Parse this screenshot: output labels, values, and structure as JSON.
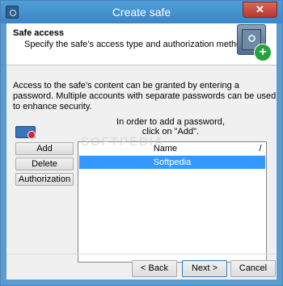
{
  "window": {
    "title": "Create safe",
    "close": "✕"
  },
  "header": {
    "title": "Safe access",
    "subtitle": "Specify the safe’s access type and authorization method."
  },
  "info": "Access to the safe’s content can be granted by entering a password. Multiple accounts with separate passwords can be used to enhance security.",
  "hint": {
    "line1": "In order to add a password,",
    "line2": "click on \"Add\"."
  },
  "buttons": {
    "add": "Add",
    "delete": "Delete",
    "authorization": "Authorization"
  },
  "list": {
    "columns": {
      "name": "Name",
      "sort": "/"
    },
    "rows": [
      {
        "name": "Softpedia",
        "selected": true
      }
    ]
  },
  "watermark": "SOFTPEDIA",
  "footer": {
    "back": "< Back",
    "next": "Next >",
    "cancel": "Cancel"
  },
  "colors": {
    "selection": "#3399ff",
    "titlebar": "#3b86c6",
    "close": "#c24a3f",
    "badge": "#27a33b"
  },
  "icons": {
    "app": "safe-icon",
    "header": "safe-icon",
    "badge": "plus-icon",
    "account": "user-lock-icon"
  }
}
